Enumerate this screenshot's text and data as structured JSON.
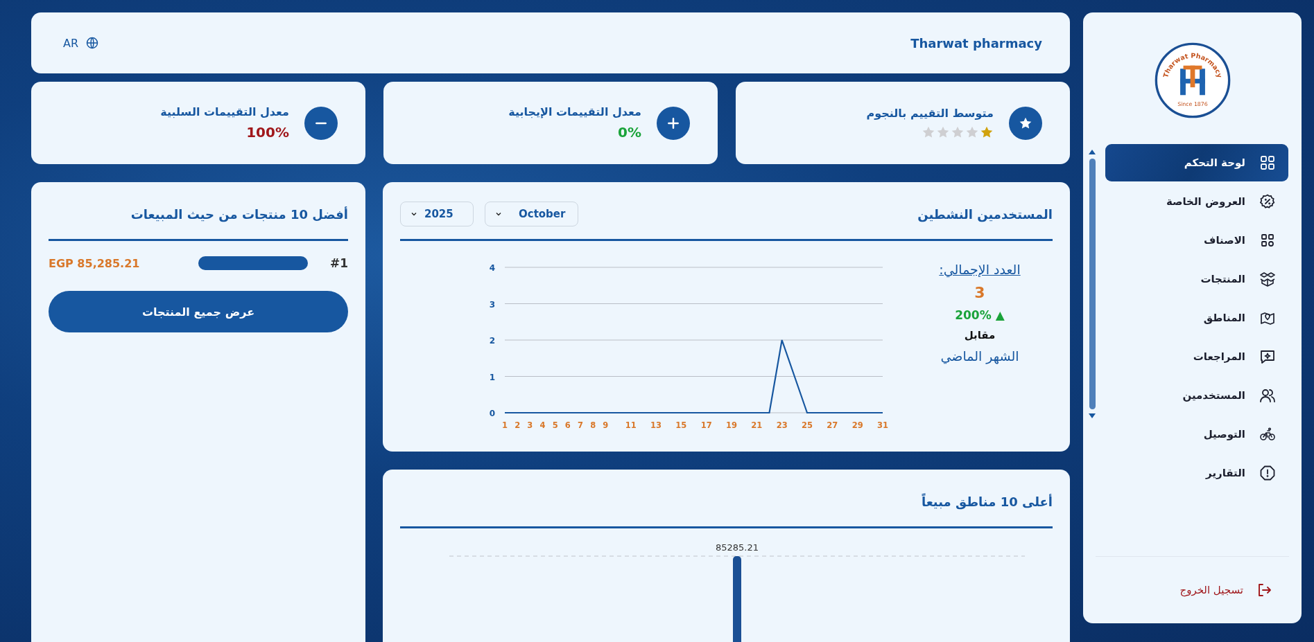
{
  "header": {
    "title": "Tharwat pharmacy",
    "language": "AR"
  },
  "stats": [
    {
      "kind": "stars",
      "title": "متوسط التقييم بالنجوم",
      "stars": 1
    },
    {
      "kind": "positive",
      "title": "معدل التقييمات الإيجابية",
      "value": "0%"
    },
    {
      "kind": "negative",
      "title": "معدل التقييمات السلبية",
      "value": "100%"
    }
  ],
  "active_users": {
    "title": "المستخدمين النشطين",
    "month": "October",
    "year": "2025",
    "total_label": "العدد الإجمالي:",
    "total": "3",
    "change": "200%",
    "change_arrow": "▲",
    "compare_label": "مقابل",
    "compare_period": "الشهر الماضي",
    "chart_data": {
      "type": "line",
      "x": [
        1,
        2,
        3,
        4,
        5,
        6,
        7,
        8,
        9,
        10,
        11,
        12,
        13,
        14,
        15,
        16,
        17,
        18,
        19,
        20,
        21,
        22,
        23,
        24,
        25,
        26,
        27,
        28,
        29,
        30,
        31
      ],
      "values": [
        0,
        0,
        0,
        0,
        0,
        0,
        0,
        0,
        0,
        0,
        0,
        0,
        0,
        0,
        0,
        0,
        0,
        0,
        0,
        0,
        0,
        0,
        2,
        1,
        0,
        0,
        0,
        0,
        0,
        0,
        0
      ],
      "xticks": [
        1,
        2,
        3,
        4,
        5,
        6,
        7,
        8,
        9,
        11,
        13,
        15,
        17,
        19,
        21,
        23,
        25,
        27,
        29,
        31
      ],
      "yticks": [
        0,
        1,
        2,
        3,
        4
      ],
      "xlim": [
        1,
        31
      ],
      "ylim": [
        0,
        4
      ],
      "grid": true
    }
  },
  "top_regions": {
    "title": "أعلى 10 مناطق مبيعاً",
    "bars": [
      {
        "label": "85285.21"
      }
    ]
  },
  "top_products": {
    "title": "أفضل 10 منتجات من حيث المبيعات",
    "items": [
      {
        "rank": "#1",
        "level": 1,
        "value": "EGP 85,285.21"
      }
    ],
    "button": "عرض جميع المنتجات"
  },
  "sidebar": {
    "logo": {
      "name": "Tharwat Pharmacy",
      "since": "Since 1876"
    },
    "items": [
      {
        "label": "لوحة التحكم",
        "selected": true
      },
      {
        "label": "العروض الخاصة",
        "selected": false
      },
      {
        "label": "الاصناف",
        "selected": false
      },
      {
        "label": "المنتجات",
        "selected": false
      },
      {
        "label": "المناطق",
        "selected": false
      },
      {
        "label": "المراجعات",
        "selected": false
      },
      {
        "label": "المستخدمين",
        "selected": false
      },
      {
        "label": "التوصيل",
        "selected": false
      },
      {
        "label": "التقارير",
        "selected": false
      }
    ],
    "logout": "تسجيل الخروج"
  }
}
